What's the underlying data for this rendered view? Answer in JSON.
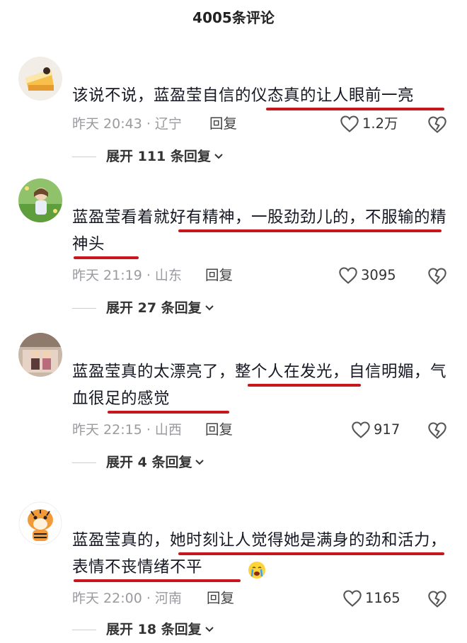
{
  "header": {
    "title": "4005条评论"
  },
  "comments": [
    {
      "text": "该说不说，蓝盈莹自信的仪态真的让人眼前一亮",
      "time": "昨天 20:43",
      "location": "辽宁",
      "reply_label": "回复",
      "likes": "1.2万",
      "expand": "展开 111 条回复"
    },
    {
      "text": "蓝盈莹看着就好有精神，一股劲劲儿的，不服输的精神头",
      "time": "昨天 21:19",
      "location": "山东",
      "reply_label": "回复",
      "likes": "3095",
      "expand": "展开 27 条回复"
    },
    {
      "text": "蓝盈莹真的太漂亮了，整个人在发光，自信明媚，气血很足的感觉",
      "time": "昨天 22:15",
      "location": "山西",
      "reply_label": "回复",
      "likes": "917",
      "expand": "展开 4 条回复"
    },
    {
      "text": "蓝盈莹真的，她时刻让人觉得她是满身的劲和活力，表情不丧情绪不平",
      "time": "昨天 22:00",
      "location": "河南",
      "reply_label": "回复",
      "likes": "1165",
      "expand": "展开 18 条回复"
    }
  ],
  "colors": {
    "underline": "#c8161d",
    "meta": "#9a9aa0"
  },
  "icons": [
    "heart-icon",
    "dislike-icon",
    "chevron-down-icon",
    "crying-emoji-icon"
  ]
}
